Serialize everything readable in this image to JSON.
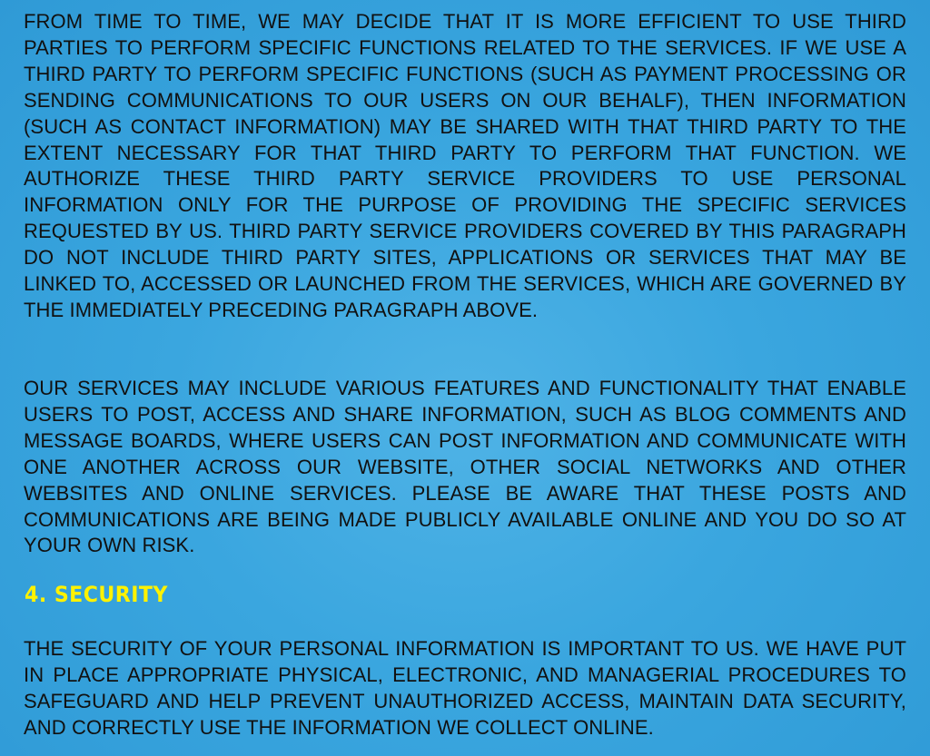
{
  "paragraphs": {
    "third_parties": "FROM TIME TO TIME, WE MAY DECIDE THAT IT IS MORE EFFICIENT TO USE THIRD PARTIES TO PERFORM SPECIFIC FUNCTIONS RELATED TO THE SERVICES. IF WE USE A THIRD PARTY TO PERFORM SPECIFIC FUNCTIONS (SUCH AS PAYMENT PRO­CESSING OR SENDING COMMUNICATIONS TO OUR USERS ON OUR BEHALF), THEN INFORMATION (SUCH AS CONTACT INFORMATION) MAY BE SHARED WITH THAT THIRD PARTY TO THE EXTENT NECESSARY FOR THAT THIRD PARTY TO PERFORM THAT FUNCTION. WE AUTHORIZE THESE THIRD PARTY SERVICE PROVIDERS TO USE PERSONAL INFORMATION ONLY FOR THE PURPOSE OF PROVIDING THE SPE­CIFIC SERVICES REQUESTED BY US. THIRD PARTY SERVICE PROVIDERS COVERED BY THIS PARAGRAPH DO NOT INCLUDE THIRD PARTY SITES, APPLICATIONS OR SERVICES THAT MAY BE LINKED TO, ACCESSED OR LAUNCHED FROM THE SER­VICES, WHICH ARE GOVERNED BY THE IMMEDIATELY PRECEDING PARAGRAPH ABOVE.",
    "public_features": "OUR SERVICES MAY INCLUDE VARIOUS FEATURES AND FUNCTIONALITY THAT ENABLE USERS TO POST, ACCESS AND SHARE INFORMATION, SUCH AS BLOG COM­MENTS AND MESSAGE BOARDS, WHERE USERS CAN POST INFORMATION AND COMMUNICATE WITH ONE ANOTHER ACROSS OUR WEBSITE, OTHER SOCIAL NET­WORKS AND OTHER WEBSITES AND ONLINE SERVICES. PLEASE BE AWARE THAT THESE POSTS AND COMMUNICATIONS ARE BEING MADE PUBLICLY AVAILABLE ONLINE AND YOU DO SO AT YOUR OWN RISK.",
    "security": "THE SECURITY OF YOUR PERSONAL INFORMATION IS IMPORTANT TO US. WE HAVE PUT IN PLACE APPROPRIATE PHYSICAL, ELECTRONIC, AND MANAGERIAL PROCE­DURES TO SAFEGUARD AND HELP PREVENT UNAUTHORIZED ACCESS, MAINTAIN DATA SECURITY, AND CORRECTLY USE THE INFORMATION WE COLLECT ONLINE."
  },
  "headings": {
    "security": "4. SECURITY"
  },
  "colors": {
    "background": "#3aa6df",
    "body_text": "#111111",
    "heading": "#fff200"
  }
}
